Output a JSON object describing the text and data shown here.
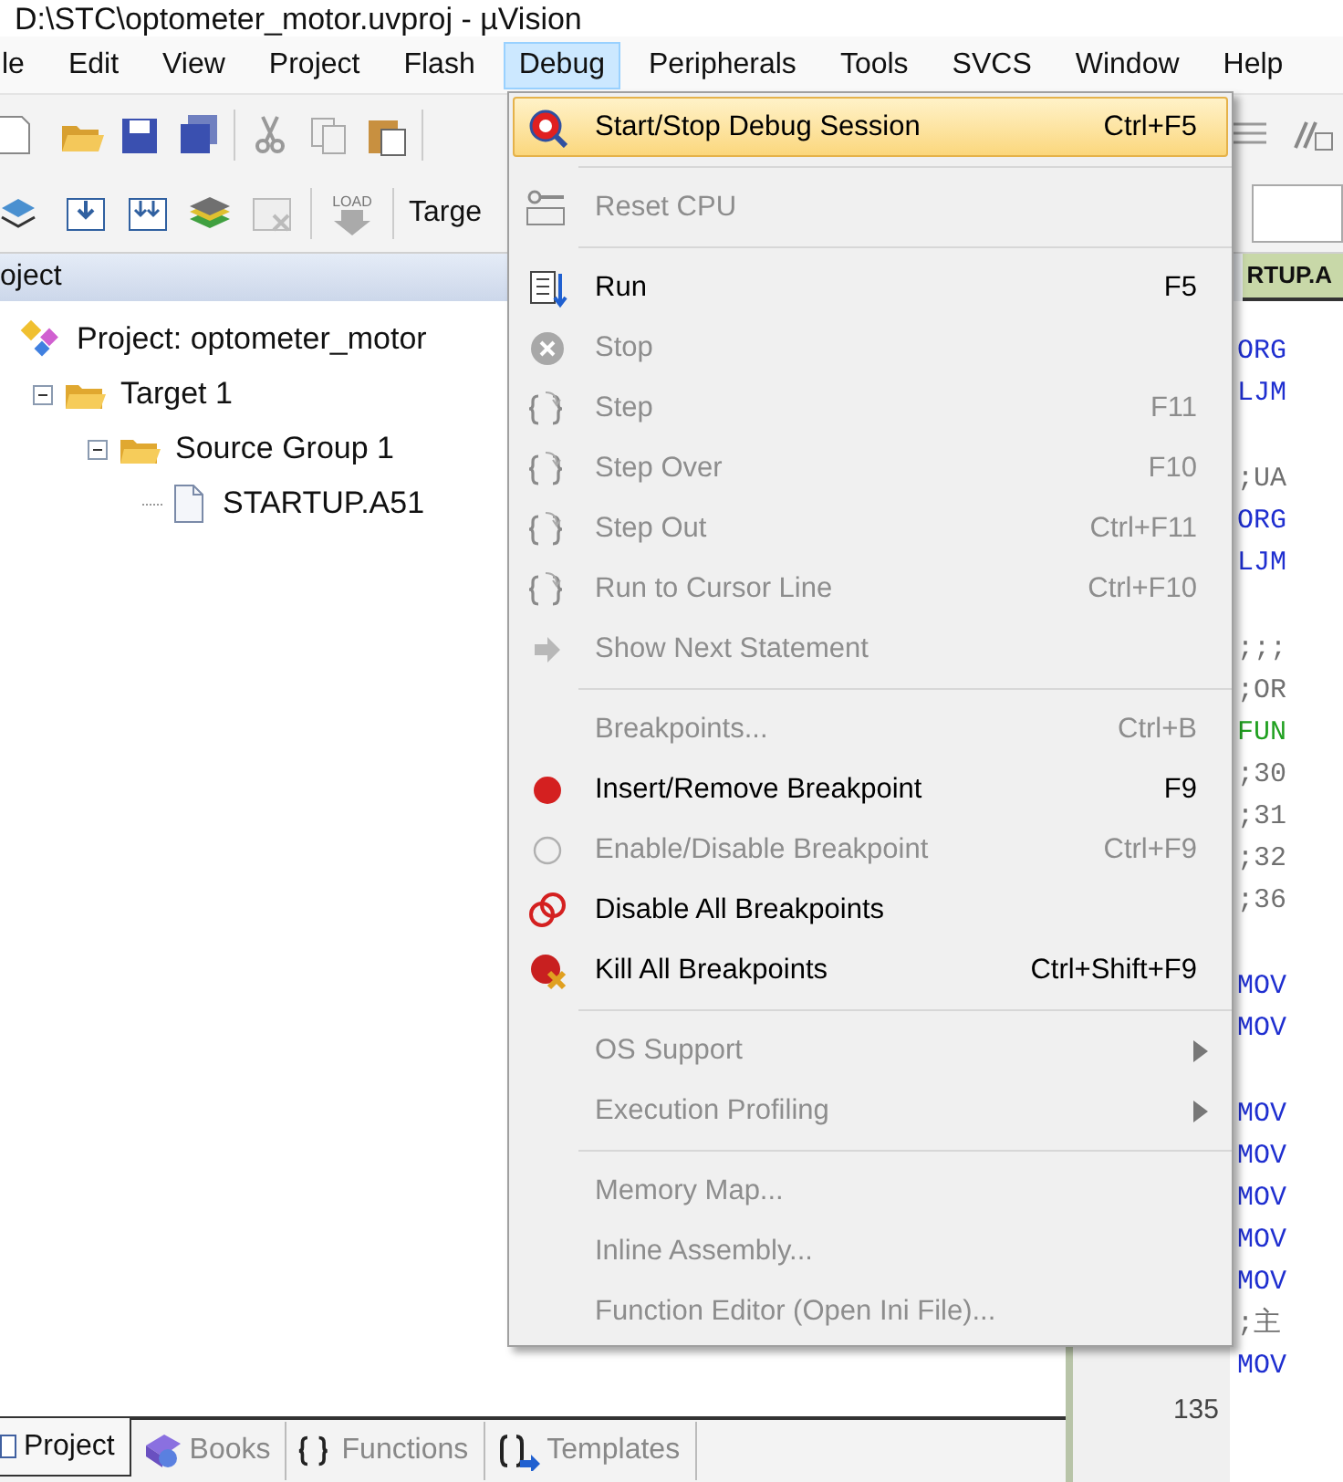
{
  "window": {
    "title": "D:\\STC\\optometer_motor.uvproj - µVision"
  },
  "menubar": [
    {
      "label": "le",
      "selected": false
    },
    {
      "label": "Edit",
      "selected": false
    },
    {
      "label": "View",
      "selected": false
    },
    {
      "label": "Project",
      "selected": false
    },
    {
      "label": "Flash",
      "selected": false
    },
    {
      "label": "Debug",
      "selected": true
    },
    {
      "label": "Peripherals",
      "selected": false
    },
    {
      "label": "Tools",
      "selected": false
    },
    {
      "label": "SVCS",
      "selected": false
    },
    {
      "label": "Window",
      "selected": false
    },
    {
      "label": "Help",
      "selected": false
    }
  ],
  "toolbar": {
    "load_icon_label": "LOAD",
    "target_field": "Targe"
  },
  "project_panel": {
    "title": "oject",
    "tree": [
      {
        "label": "Project: optometer_motor",
        "children": [
          {
            "label": "Target 1",
            "expanded": true,
            "children": [
              {
                "label": "Source Group 1",
                "expanded": true,
                "children": [
                  {
                    "label": "STARTUP.A51"
                  }
                ]
              }
            ]
          }
        ]
      }
    ],
    "tabs": [
      {
        "label": "Project",
        "selected": true
      },
      {
        "label": "Books",
        "selected": false
      },
      {
        "label": "Functions",
        "selected": false
      },
      {
        "label": "Templates",
        "selected": false
      }
    ]
  },
  "editor": {
    "tab": "RTUP.A",
    "line_number": "135",
    "lines": [
      {
        "kind": "code",
        "text": "ORG"
      },
      {
        "kind": "code",
        "text": "LJM"
      },
      {
        "kind": "blank"
      },
      {
        "kind": "comment",
        "text": ";UA"
      },
      {
        "kind": "code",
        "text": "ORG"
      },
      {
        "kind": "code",
        "text": "LJM"
      },
      {
        "kind": "blank"
      },
      {
        "kind": "comment",
        "text": ";;;"
      },
      {
        "kind": "comment",
        "text": ";OR"
      },
      {
        "kind": "label",
        "text": "FUN"
      },
      {
        "kind": "comment",
        "text": ";30"
      },
      {
        "kind": "comment",
        "text": ";31"
      },
      {
        "kind": "comment",
        "text": ";32"
      },
      {
        "kind": "comment",
        "text": ";36"
      },
      {
        "kind": "blank"
      },
      {
        "kind": "code",
        "text": "MOV"
      },
      {
        "kind": "code",
        "text": "MOV"
      },
      {
        "kind": "blank"
      },
      {
        "kind": "code",
        "text": "MOV"
      },
      {
        "kind": "code",
        "text": "MOV"
      },
      {
        "kind": "code",
        "text": "MOV"
      },
      {
        "kind": "code",
        "text": "MOV"
      },
      {
        "kind": "code",
        "text": "MOV"
      },
      {
        "kind": "comment",
        "text": ";主"
      },
      {
        "kind": "code",
        "text": "MOV"
      }
    ]
  },
  "debug_menu": [
    {
      "kind": "command",
      "label": "Start/Stop Debug Session",
      "shortcut": "Ctrl+F5",
      "disabled": false,
      "selected": true
    },
    {
      "kind": "separator"
    },
    {
      "kind": "command",
      "label": "Reset CPU",
      "disabled": true,
      "selected": false
    },
    {
      "kind": "separator"
    },
    {
      "kind": "command",
      "label": "Run",
      "shortcut": "F5",
      "disabled": false,
      "selected": false
    },
    {
      "kind": "command",
      "label": "Stop",
      "disabled": true,
      "selected": false
    },
    {
      "kind": "command",
      "label": "Step",
      "shortcut": "F11",
      "disabled": true,
      "selected": false
    },
    {
      "kind": "command",
      "label": "Step Over",
      "shortcut": "F10",
      "disabled": true,
      "selected": false
    },
    {
      "kind": "command",
      "label": "Step Out",
      "shortcut": "Ctrl+F11",
      "disabled": true,
      "selected": false
    },
    {
      "kind": "command",
      "label": "Run to Cursor Line",
      "shortcut": "Ctrl+F10",
      "disabled": true,
      "selected": false
    },
    {
      "kind": "command",
      "label": "Show Next Statement",
      "disabled": true,
      "selected": false
    },
    {
      "kind": "separator"
    },
    {
      "kind": "command",
      "label": "Breakpoints...",
      "shortcut": "Ctrl+B",
      "disabled": true,
      "selected": false
    },
    {
      "kind": "command",
      "label": "Insert/Remove Breakpoint",
      "shortcut": "F9",
      "disabled": false,
      "selected": false
    },
    {
      "kind": "command",
      "label": "Enable/Disable Breakpoint",
      "shortcut": "Ctrl+F9",
      "disabled": true,
      "selected": false
    },
    {
      "kind": "command",
      "label": "Disable All Breakpoints",
      "disabled": false,
      "selected": false
    },
    {
      "kind": "command",
      "label": "Kill All Breakpoints",
      "shortcut": "Ctrl+Shift+F9",
      "disabled": false,
      "selected": false
    },
    {
      "kind": "separator"
    },
    {
      "kind": "submenu",
      "label": "OS Support",
      "disabled": true,
      "selected": false
    },
    {
      "kind": "submenu",
      "label": "Execution Profiling",
      "disabled": true,
      "selected": false
    },
    {
      "kind": "separator"
    },
    {
      "kind": "command",
      "label": "Memory Map...",
      "disabled": true,
      "selected": false
    },
    {
      "kind": "command",
      "label": "Inline Assembly...",
      "disabled": true,
      "selected": false
    },
    {
      "kind": "command",
      "label": "Function Editor (Open Ini File)...",
      "disabled": true,
      "selected": false
    }
  ]
}
